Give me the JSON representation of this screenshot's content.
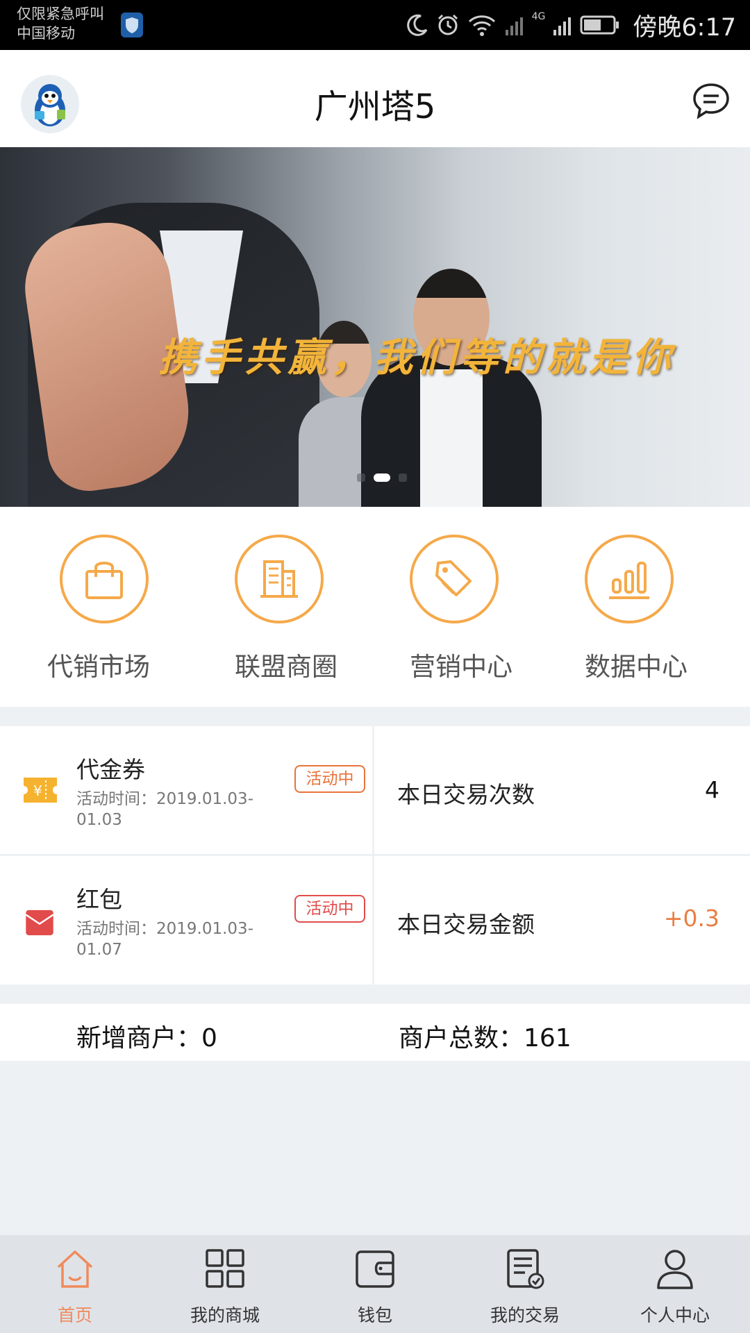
{
  "status_bar": {
    "carrier_line1": "仅限紧急呼叫",
    "carrier_line2": "中国移动",
    "network": "4G",
    "time": "傍晚6:17",
    "icons": [
      "shield-icon",
      "moon-icon",
      "alarm-icon",
      "wifi-icon",
      "signal-icon",
      "battery-icon"
    ]
  },
  "header": {
    "title": "广州塔5",
    "avatar_icon": "penguin-avatar",
    "message_icon": "message-icon"
  },
  "banner": {
    "slogan": "携手共赢，我们等的就是你",
    "slide_count": 3,
    "active_slide": 2
  },
  "quick_menu": [
    {
      "label": "代销市场",
      "icon": "shopping-bag-icon"
    },
    {
      "label": "联盟商圈",
      "icon": "building-icon"
    },
    {
      "label": "营销中心",
      "icon": "tag-icon"
    },
    {
      "label": "数据中心",
      "icon": "bar-chart-icon"
    }
  ],
  "promotions": [
    {
      "name": "代金券",
      "time": "活动时间：2019.01.03-01.03",
      "status": "活动中",
      "icon": "voucher-icon",
      "color": "#f5b22e"
    },
    {
      "name": "红包",
      "time": "活动时间：2019.01.03-01.07",
      "status": "活动中",
      "icon": "red-envelope-icon",
      "color": "#e14b4b"
    }
  ],
  "stats": {
    "daily_count_label": "本日交易次数",
    "daily_count_value": "4",
    "daily_amount_label": "本日交易金额",
    "daily_amount_value": "+0.3"
  },
  "summary": {
    "new_merchants": "新增商户：0",
    "total_merchants": "商户总数：161"
  },
  "tab_bar": [
    {
      "label": "首页",
      "icon": "home-icon",
      "active": true
    },
    {
      "label": "我的商城",
      "icon": "grid-icon",
      "active": false
    },
    {
      "label": "钱包",
      "icon": "wallet-icon",
      "active": false
    },
    {
      "label": "我的交易",
      "icon": "transaction-icon",
      "active": false
    },
    {
      "label": "个人中心",
      "icon": "person-icon",
      "active": false
    }
  ],
  "colors": {
    "accent_orange": "#f5a94a",
    "active_tab": "#f08a5b",
    "badge_orange": "#e8733a",
    "badge_red": "#e14b4b"
  }
}
